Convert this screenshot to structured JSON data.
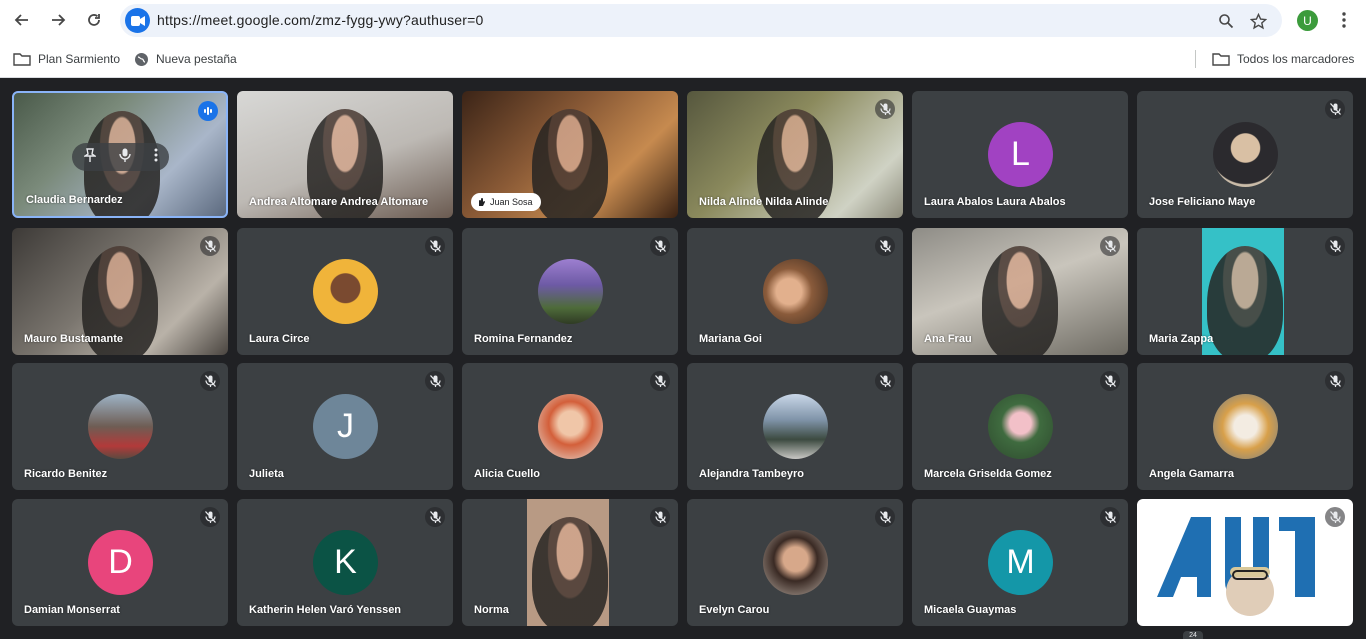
{
  "browser": {
    "url": "https://meet.google.com/zmz-fygg-ywy?authuser=0",
    "profile_initial": "U",
    "icons": [
      "back-arrow-icon",
      "forward-arrow-icon",
      "reload-icon",
      "meet-site-icon",
      "zoom-icon",
      "star-icon",
      "more-vert-icon"
    ]
  },
  "bookmarks": {
    "items": [
      {
        "label": "Plan Sarmiento",
        "icon": "folder-icon"
      },
      {
        "label": "Nueva pestaña",
        "icon": "globe-icon"
      }
    ],
    "all_bookmarks": "Todos los marcadores"
  },
  "meeting": {
    "participants": [
      {
        "name": "Claudia Bernardez",
        "kind": "video",
        "active": true
      },
      {
        "name": "Andrea Altomare Andrea Altomare",
        "kind": "video"
      },
      {
        "name": "Juan Sosa",
        "kind": "video",
        "chip": true
      },
      {
        "name": "Nilda Alinde Nilda Alinde",
        "kind": "video",
        "muted": true
      },
      {
        "name": "Laura Abalos Laura Abalos",
        "kind": "avatar",
        "letter": "L",
        "color": "#a142c2"
      },
      {
        "name": "Jose Feliciano Maye",
        "kind": "photo",
        "muted": true
      },
      {
        "name": "Mauro Bustamante",
        "kind": "video",
        "muted": true
      },
      {
        "name": "Laura Circe",
        "kind": "photo",
        "muted": true
      },
      {
        "name": "Romina Fernandez",
        "kind": "photo",
        "muted": true
      },
      {
        "name": "Mariana Goi",
        "kind": "photo",
        "muted": true
      },
      {
        "name": "Ana Frau",
        "kind": "video",
        "muted": true
      },
      {
        "name": "Maria Zappa",
        "kind": "video",
        "muted": true
      },
      {
        "name": "Ricardo Benitez",
        "kind": "photo",
        "muted": true
      },
      {
        "name": "Julieta",
        "kind": "avatar",
        "letter": "J",
        "color": "#6e8699",
        "muted": true
      },
      {
        "name": "Alicia Cuello",
        "kind": "photo",
        "muted": true
      },
      {
        "name": "Alejandra Tambeyro",
        "kind": "photo",
        "muted": true
      },
      {
        "name": "Marcela Griselda Gomez",
        "kind": "photo",
        "muted": true
      },
      {
        "name": "Angela Gamarra",
        "kind": "photo",
        "muted": true
      },
      {
        "name": "Damian Monserrat",
        "kind": "avatar",
        "letter": "D",
        "color": "#e8457c",
        "muted": true
      },
      {
        "name": "Katherin Helen Varó Yenssen",
        "kind": "avatar",
        "letter": "K",
        "color": "#0b5345",
        "muted": true
      },
      {
        "name": "Norma",
        "kind": "video",
        "muted": true
      },
      {
        "name": "Evelyn Carou",
        "kind": "photo",
        "muted": true
      },
      {
        "name": "Micaela Guaymas",
        "kind": "avatar",
        "letter": "M",
        "color": "#1497a8",
        "muted": true
      },
      {
        "name": "",
        "kind": "logo",
        "muted": true
      }
    ],
    "overflow_count": "24"
  }
}
